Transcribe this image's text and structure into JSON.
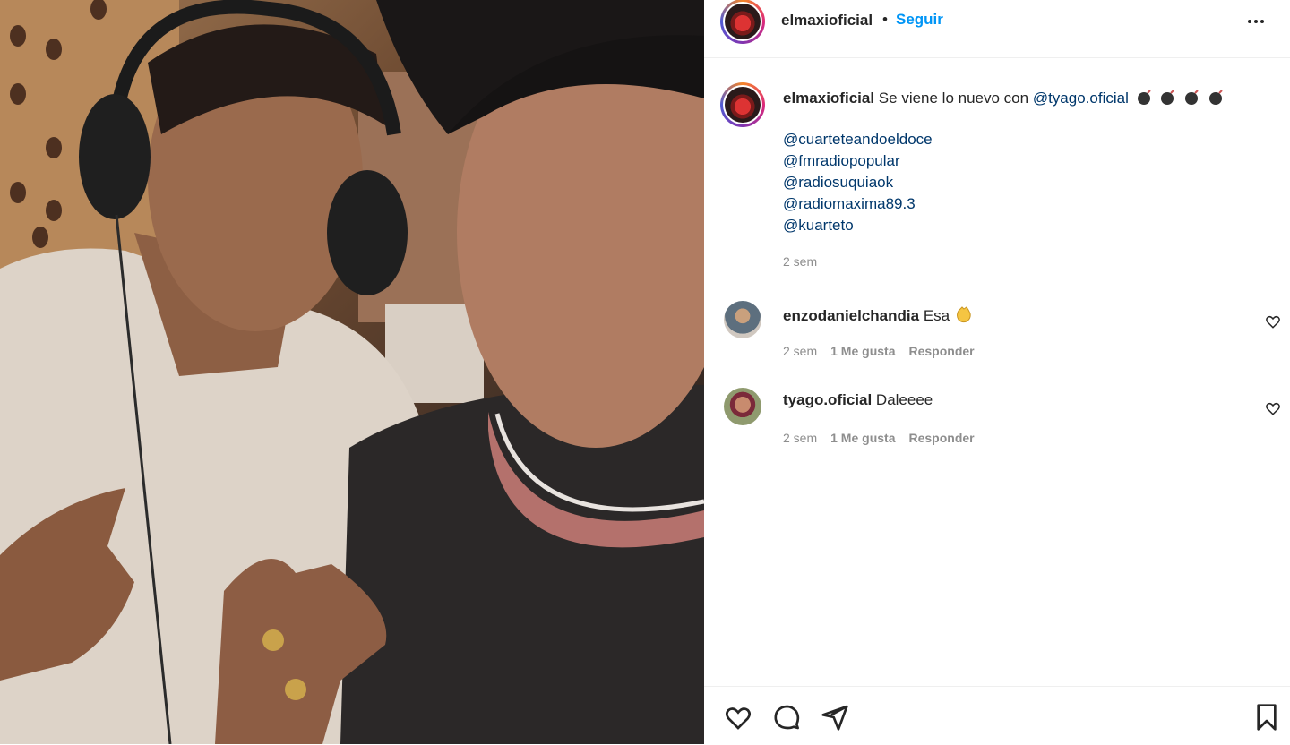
{
  "post": {
    "author": "elmaxioficial",
    "dot": "•",
    "follow_label": "Seguir",
    "more_icon": "more-icon"
  },
  "caption": {
    "author": "elmaxioficial",
    "text": "Se viene lo nuevo con",
    "mention": "@tyago.oficial",
    "emoji_icon": "bomb-icon",
    "mentions": [
      "@cuarteteandoeldoce",
      "@fmradiopopular",
      "@radiosuquiaok",
      "@radiomaxima89.3",
      "@kuarteto"
    ],
    "time": "2 sem"
  },
  "comments": [
    {
      "user": "enzodanielchandia",
      "text": "Esa",
      "emoji_icon": "clapping-hands-icon",
      "time": "2 sem",
      "likes": "1 Me gusta",
      "reply": "Responder"
    },
    {
      "user": "tyago.oficial",
      "text": "Daleeee",
      "time": "2 sem",
      "likes": "1 Me gusta",
      "reply": "Responder"
    }
  ],
  "actions": {
    "like_icon": "heart-icon",
    "comment_icon": "comment-icon",
    "share_icon": "send-icon",
    "save_icon": "bookmark-icon"
  },
  "colors": {
    "link": "#0095f6",
    "mention": "#00376b",
    "muted": "#8e8e8e",
    "text": "#262626"
  }
}
